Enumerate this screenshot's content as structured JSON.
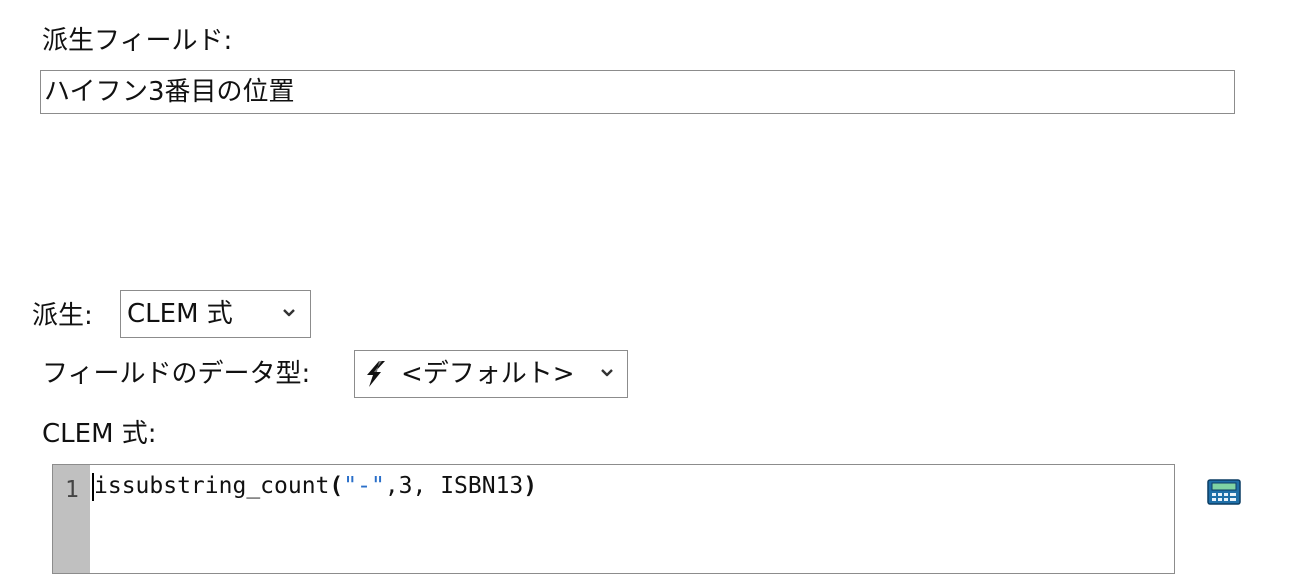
{
  "derived_field": {
    "label": "派生フィールド:",
    "value": "ハイフン3番目の位置"
  },
  "derive": {
    "label": "派生:",
    "selected": "CLEM 式"
  },
  "field_type": {
    "label": "フィールドのデータ型:",
    "selected": "<デフォルト>",
    "icon": "lightning-icon"
  },
  "expression": {
    "label": "CLEM 式:",
    "line_number": "1",
    "code": {
      "func": "issubstring_count",
      "open_paren": "(",
      "string_literal": "\"-\"",
      "args": ",3, ISBN13",
      "close_paren": ")"
    }
  },
  "expression_builder_icon": "calculator-icon",
  "colors": {
    "gutter": "#c0c0c0",
    "string_literal": "#2a6fc9",
    "calculator_body": "#1f6fa8",
    "calculator_display": "#7fd4a4"
  }
}
